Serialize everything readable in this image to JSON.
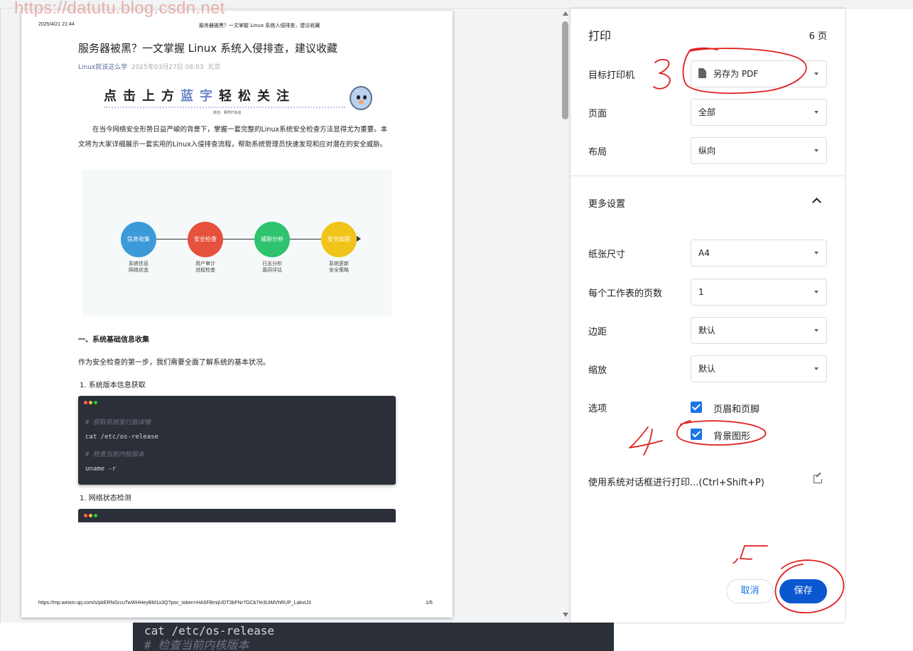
{
  "watermark": "https://datutu.blog.csdn.net",
  "page": {
    "header_date": "2025/4/21 21:44",
    "header_title": "服务器被黑？一文掌握 Linux 系统入侵排查，建议收藏",
    "title": "服务器被黑？一文掌握 Linux 系统入侵排查，建议收藏",
    "author": "Linux就该这么学",
    "date": "2025年03月27日 08:03",
    "location": "北京",
    "banner": {
      "part1": "点击上方",
      "part2": "蓝字",
      "part3": "轻松关注",
      "sub": "转自：释然IT杂谈"
    },
    "intro": "在当今网络安全形势日益严峻的背景下，掌握一套完整的Linux系统安全检查方法显得尤为重要。本文将为大家详细展示一套实用的Linux入侵排查流程，帮助系统管理员快速发现和应对潜在的安全威胁。",
    "diagram": {
      "nodes": [
        {
          "label": "信息收集",
          "color": "#3d9ad9",
          "sub1": "系统信息",
          "sub2": "网络状态"
        },
        {
          "label": "安全检查",
          "color": "#e6513d",
          "sub1": "用户审计",
          "sub2": "进程检查"
        },
        {
          "label": "威胁分析",
          "color": "#2fc26f",
          "sub1": "日志分析",
          "sub2": "漏洞评估"
        },
        {
          "label": "安全加固",
          "color": "#f0c419",
          "sub1": "系统更新",
          "sub2": "安全策略"
        }
      ]
    },
    "section1_heading": "一、系统基础信息收集",
    "section1_text": "作为安全检查的第一步，我们需要全面了解系统的基本状况。",
    "item1": "1. 系统版本信息获取",
    "code1": {
      "comment1": "# 获取系统发行版详情",
      "cmd1": "cat /etc/os-release",
      "comment2": "# 检查当前内核版本",
      "cmd2": "uname -r"
    },
    "item2": "1. 网络状态检测",
    "footer_url": "https://mp.weixin.qq.com/s/pkERNGrcuTwWHHeyBM1o3Q?poc_token=HA5FBmijUDT3bFNr7GCb7Ie3UiMVhRUP_LakvtJ3",
    "footer_page": "1/6"
  },
  "underlay": {
    "line1": "cat /etc/os-release",
    "line2": "# 检查当前内核版本"
  },
  "print": {
    "title": "打印",
    "page_count": "6 页",
    "destination_label": "目标打印机",
    "destination_value": "另存为 PDF",
    "pages_label": "页面",
    "pages_value": "全部",
    "layout_label": "布局",
    "layout_value": "纵向",
    "more_settings": "更多设置",
    "paper_label": "纸张尺寸",
    "paper_value": "A4",
    "pps_label": "每个工作表的页数",
    "pps_value": "1",
    "margin_label": "边距",
    "margin_value": "默认",
    "scale_label": "缩放",
    "scale_value": "默认",
    "options_label": "选项",
    "option1": "页眉和页脚",
    "option1_checked": true,
    "option2": "背景图形",
    "option2_checked": true,
    "system_dialog": "使用系统对话框进行打印...(Ctrl+Shift+P)",
    "cancel": "取消",
    "save": "保存"
  },
  "annotations": {
    "n3": "3",
    "n4": "4",
    "n5": "5",
    "ink_color": "#e02020"
  }
}
